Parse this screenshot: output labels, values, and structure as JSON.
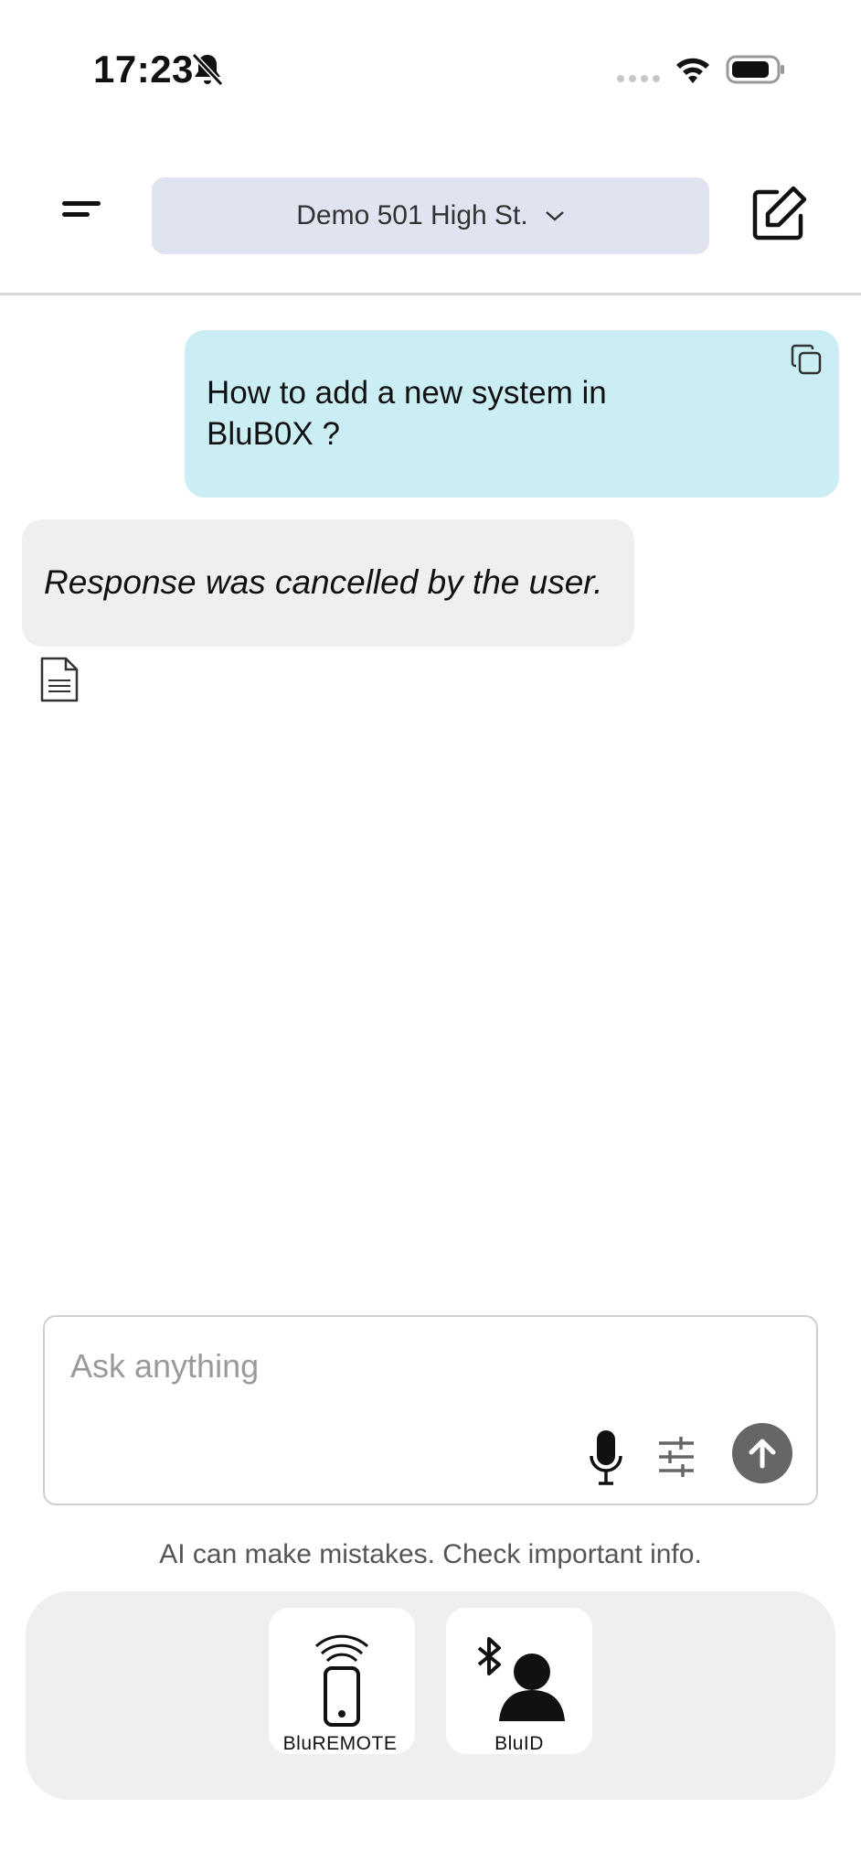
{
  "status_bar": {
    "time": "17:23",
    "bell_icon": "bell-slash-icon",
    "signal_icon": "cellular-signal-icon",
    "wifi_icon": "wifi-icon",
    "battery_icon": "battery-icon"
  },
  "header": {
    "menu_icon": "menu-icon",
    "site_selector": "Demo 501 High St.",
    "edit_icon": "compose-icon"
  },
  "chat": {
    "user_message": "How to add a new system in BluB0X ?",
    "ai_message": "Response was cancelled by the user.",
    "copy_icon": "copy-icon",
    "document_icon": "document-icon"
  },
  "composer": {
    "placeholder": "Ask anything",
    "value": "",
    "mic_icon": "microphone-icon",
    "settings_icon": "sliders-icon",
    "send_icon": "send-arrow-icon"
  },
  "disclaimer": "AI can make mistakes. Check important info.",
  "dock": {
    "items": [
      {
        "label": "BluREMOTE",
        "icon": "remote-phone-icon"
      },
      {
        "label": "BluID",
        "icon": "bluetooth-user-icon"
      }
    ]
  },
  "colors": {
    "user_bubble": "#cbeef5",
    "ai_bubble": "#efefef",
    "site_selector_bg": "#e0e3f0",
    "send_button": "#666666",
    "dock_bg": "#efefef"
  }
}
